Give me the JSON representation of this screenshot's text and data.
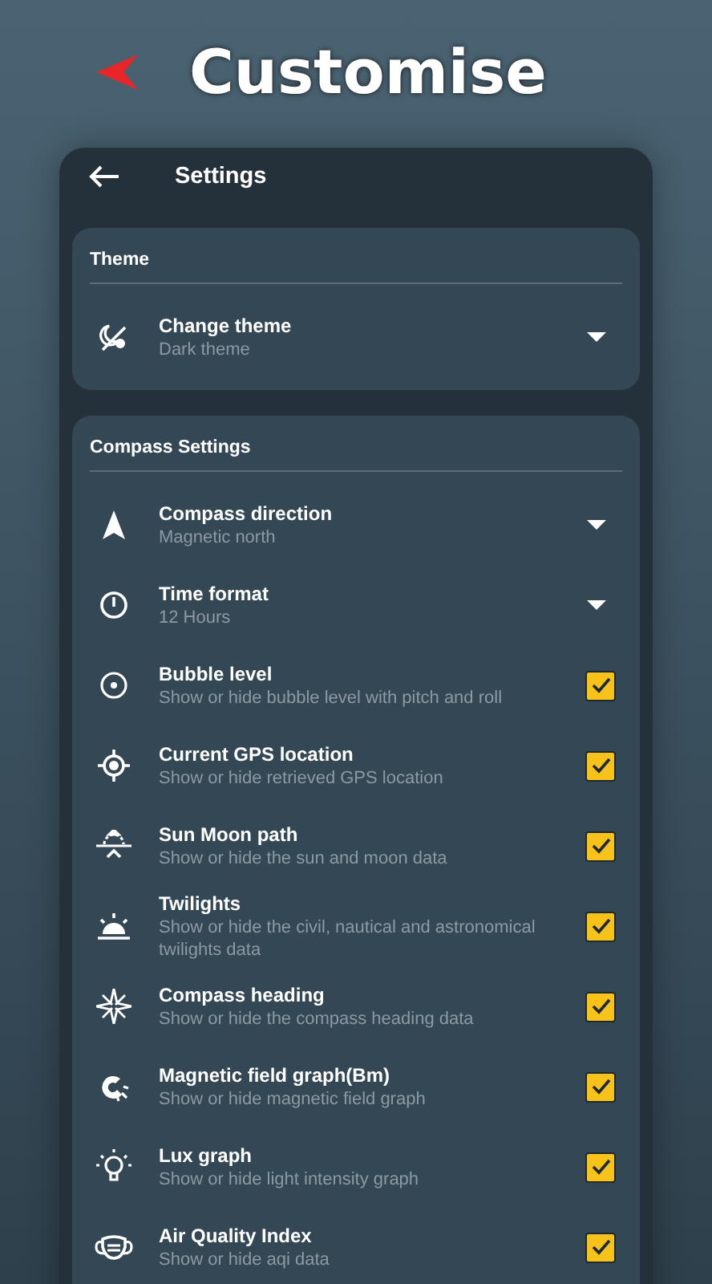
{
  "title": "Customise",
  "header": {
    "title": "Settings"
  },
  "sections": [
    {
      "title": "Theme",
      "items": [
        {
          "kind": "dropdown",
          "label": "Change theme",
          "detail": "Dark theme"
        }
      ]
    },
    {
      "title": "Compass Settings",
      "items": [
        {
          "kind": "dropdown",
          "label": "Compass direction",
          "detail": "Magnetic north"
        },
        {
          "kind": "dropdown",
          "label": "Time format",
          "detail": "12 Hours"
        },
        {
          "kind": "checkbox",
          "label": "Bubble level",
          "detail": "Show or hide bubble level with pitch and roll",
          "checked": true
        },
        {
          "kind": "checkbox",
          "label": "Current GPS location",
          "detail": "Show or hide retrieved GPS location",
          "checked": true
        },
        {
          "kind": "checkbox",
          "label": "Sun Moon path",
          "detail": "Show or hide the sun and moon data",
          "checked": true
        },
        {
          "kind": "checkbox",
          "label": "Twilights",
          "detail": "Show or hide the civil, nautical and astronomical twilights data",
          "checked": true
        },
        {
          "kind": "checkbox",
          "label": "Compass heading",
          "detail": "Show or hide the compass heading data",
          "checked": true
        },
        {
          "kind": "checkbox",
          "label": "Magnetic field graph(Bm)",
          "detail": "Show or hide magnetic field graph",
          "checked": true
        },
        {
          "kind": "checkbox",
          "label": "Lux graph",
          "detail": "Show or hide light intensity graph",
          "checked": true
        },
        {
          "kind": "checkbox",
          "label": "Air Quality Index",
          "detail": "Show or hide aqi data",
          "checked": true
        }
      ]
    }
  ]
}
